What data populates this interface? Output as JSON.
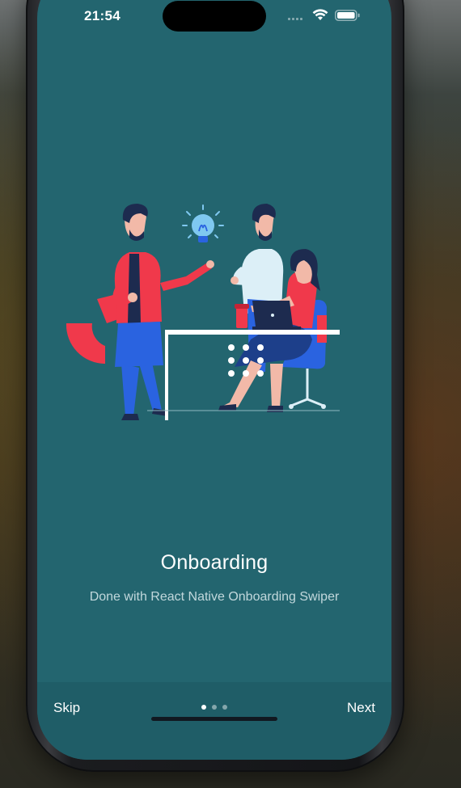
{
  "status_bar": {
    "time": "21:54",
    "icons": [
      "cellular-signal-icon",
      "wifi-icon",
      "battery-icon"
    ]
  },
  "slide": {
    "illustration": "team-meeting-illustration",
    "title": "Onboarding",
    "subtitle": "Done with React Native Onboarding Swiper"
  },
  "footer": {
    "skip_label": "Skip",
    "next_label": "Next",
    "pagination": {
      "total": 3,
      "current": 1
    }
  },
  "colors": {
    "screen_background": "#23656f",
    "footer_background": "#1f5d67",
    "accent_red": "#f0394b",
    "accent_blue": "#2a63e0"
  }
}
